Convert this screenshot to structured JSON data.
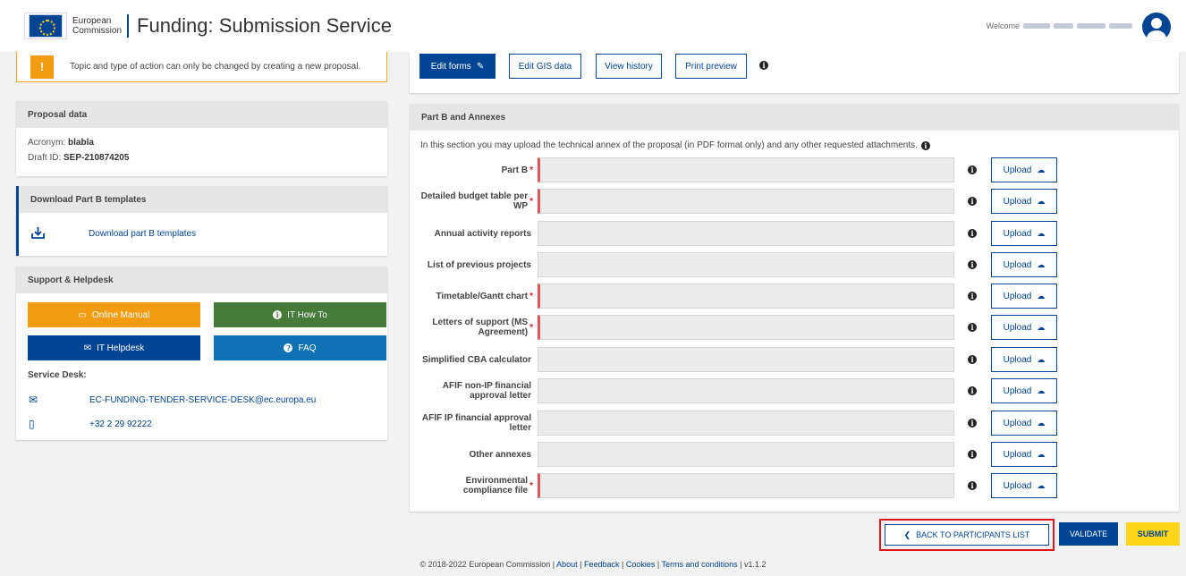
{
  "header": {
    "ec_line1": "European",
    "ec_line2": "Commission",
    "app_title": "Funding: Submission Service",
    "welcome": "Welcome"
  },
  "left": {
    "warning": "Topic and type of action can only be changed by creating a new proposal.",
    "proposal": {
      "title": "Proposal data",
      "acronym_label": "Acronym:",
      "acronym": "blabla",
      "draft_label": "Draft ID:",
      "draft_id": "SEP-210874205"
    },
    "download": {
      "title": "Download Part B templates",
      "link": "Download part B templates"
    },
    "support": {
      "title": "Support & Helpdesk",
      "online_manual": "Online Manual",
      "it_how_to": "IT How To",
      "it_helpdesk": "IT Helpdesk",
      "faq": "FAQ",
      "service_desk": "Service Desk:",
      "email": "EC-FUNDING-TENDER-SERVICE-DESK@ec.europa.eu",
      "phone": "+32 2 29 92222"
    }
  },
  "toolbar": {
    "edit_forms": "Edit forms",
    "edit_gis": "Edit GIS data",
    "view_history": "View history",
    "print_preview": "Print preview"
  },
  "annex": {
    "title": "Part B and Annexes",
    "intro": "In this section you may upload the technical annex of the proposal (in PDF format only) and any other requested attachments.",
    "upload_label": "Upload",
    "rows": [
      {
        "label": "Part B",
        "required": "*"
      },
      {
        "label": "Detailed budget table per WP",
        "required": "*"
      },
      {
        "label": "Annual activity reports",
        "required": ""
      },
      {
        "label": "List of previous projects",
        "required": ""
      },
      {
        "label": "Timetable/Gantt chart",
        "required": "*"
      },
      {
        "label": "Letters of support (MS Agreement)",
        "required": "*"
      },
      {
        "label": "Simplified CBA calculator",
        "required": ""
      },
      {
        "label": "AFIF non-IP financial approval letter",
        "required": ""
      },
      {
        "label": "AFIF IP financial approval letter",
        "required": ""
      },
      {
        "label": "Other annexes",
        "required": ""
      },
      {
        "label": "Environmental compliance file",
        "required": "*"
      }
    ]
  },
  "actions": {
    "back": "BACK TO PARTICIPANTS LIST",
    "validate": "VALIDATE",
    "submit": "SUBMIT"
  },
  "footer": {
    "copyright": "© 2018-2022 European Commission |",
    "about": "About",
    "feedback": "Feedback",
    "cookies": "Cookies",
    "terms": "Terms and conditions",
    "version": "| v1.1.2"
  },
  "colors": {
    "primary": "#004494",
    "orange": "#f39c12",
    "green": "#467a39",
    "blue": "#0e72b5",
    "yellow": "#ffd617",
    "required": "#e05656"
  }
}
